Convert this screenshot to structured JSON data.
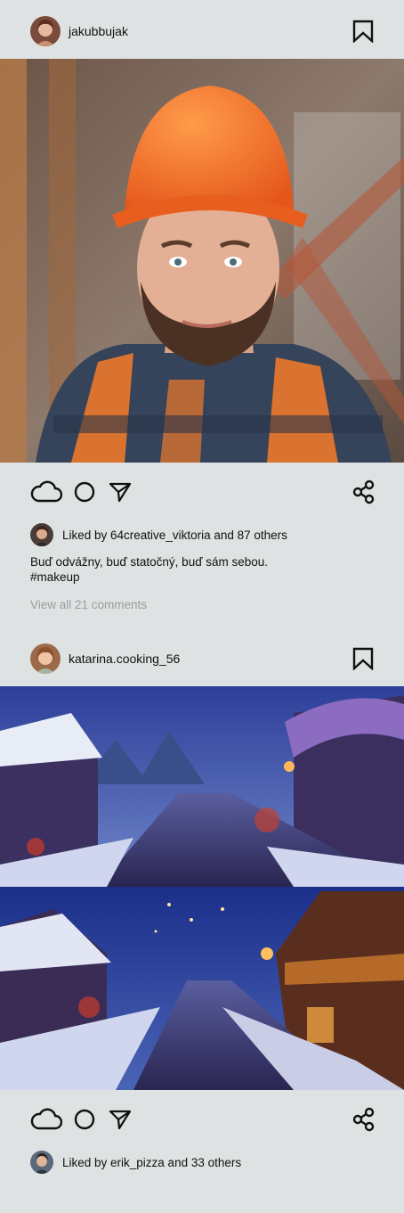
{
  "post1": {
    "username": "jakubbujak",
    "likes_text": "Liked by 64creative_viktoria and 87 others",
    "caption_line1": "Buď odvážny, buď statočný, buď sám sebou.",
    "caption_line2": "#makeup",
    "comments_link": "View all 21 comments"
  },
  "post2": {
    "username": "katarina.cooking_56",
    "likes_text": "Liked by erik_pizza and 33 others"
  },
  "icons": {
    "like": "cloud-icon",
    "comment": "circle-icon",
    "share_send": "send-icon",
    "share": "share-nodes-icon",
    "save": "bookmark-icon"
  }
}
